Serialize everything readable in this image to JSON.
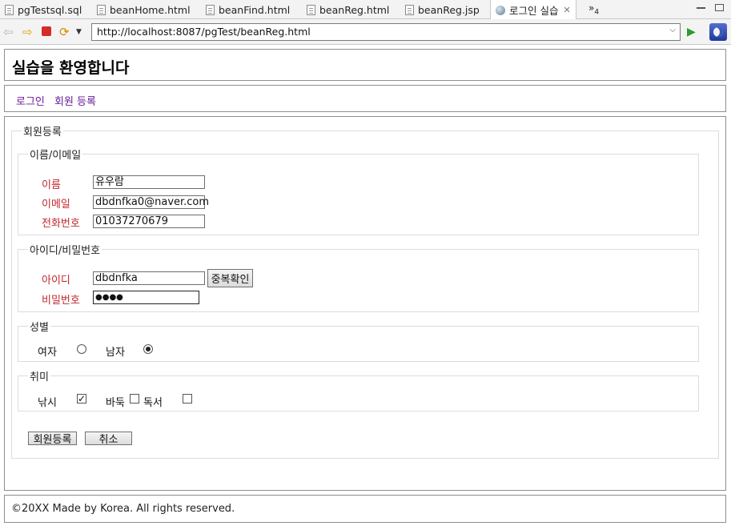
{
  "editor_tabs": [
    {
      "label": "pgTestsql.sql"
    },
    {
      "label": "beanHome.html"
    },
    {
      "label": "beanFind.html"
    },
    {
      "label": "beanReg.html"
    },
    {
      "label": "beanReg.jsp"
    },
    {
      "label": "로그인 실습",
      "active": true
    }
  ],
  "tab_overflow": {
    "symbol": "»",
    "count": "4"
  },
  "toolbar": {
    "url": "http://localhost:8087/pgTest/beanReg.html"
  },
  "page": {
    "title": "실습을 환영합니다",
    "nav": {
      "login": "로그인",
      "register": "회원 등록"
    },
    "form": {
      "legend": "회원등록",
      "name_section": {
        "legend": "이름/이메일",
        "name_label": "이름",
        "name_value": "유우람",
        "email_label": "이메일",
        "email_value": "dbdnfka0@naver.com",
        "phone_label": "전화번호",
        "phone_value": "01037270679"
      },
      "id_section": {
        "legend": "아이디/비밀번호",
        "id_label": "아이디",
        "id_value": "dbdnfka",
        "check_button": "중복확인",
        "password_label": "비밀번호",
        "password_value": "●●●●"
      },
      "gender_section": {
        "legend": "성별",
        "female": "여자",
        "male": "남자",
        "selected": "남자"
      },
      "hobby_section": {
        "legend": "취미",
        "fishing": "낚시",
        "fishing_checked": true,
        "baduk": "바둑",
        "baduk_checked": false,
        "reading": "독서",
        "reading_checked": false
      },
      "submit_button": "회원등록",
      "cancel_button": "취소"
    },
    "footer": "©20XX Made by Korea. All rights reserved."
  }
}
